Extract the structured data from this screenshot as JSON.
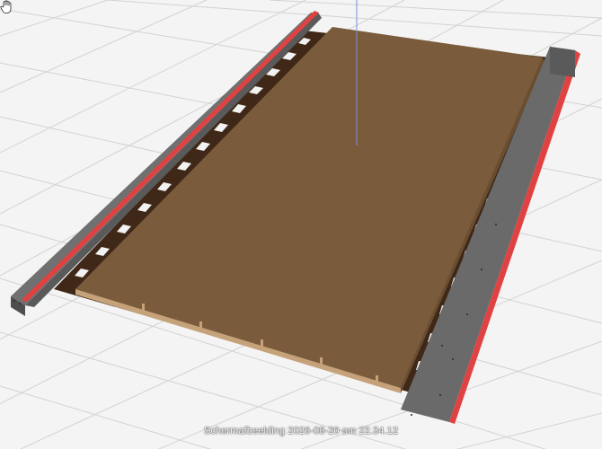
{
  "viewport": {
    "caption": "Schermafbeelding 2026-08-20 om 22.34.12",
    "cursor_icon": "hand-cursor-icon"
  },
  "colors": {
    "background": "#f4f4f4",
    "grid_line": "#d2d2d2",
    "deck_top": "#7a5c3c",
    "deck_edge": "#c6a27a",
    "joist": "#4a2e1c",
    "rail_gray": "#6a6a6a",
    "rail_dark": "#555555",
    "rail_accent": "#e04242",
    "axis_blue": "#7a8fe0"
  }
}
